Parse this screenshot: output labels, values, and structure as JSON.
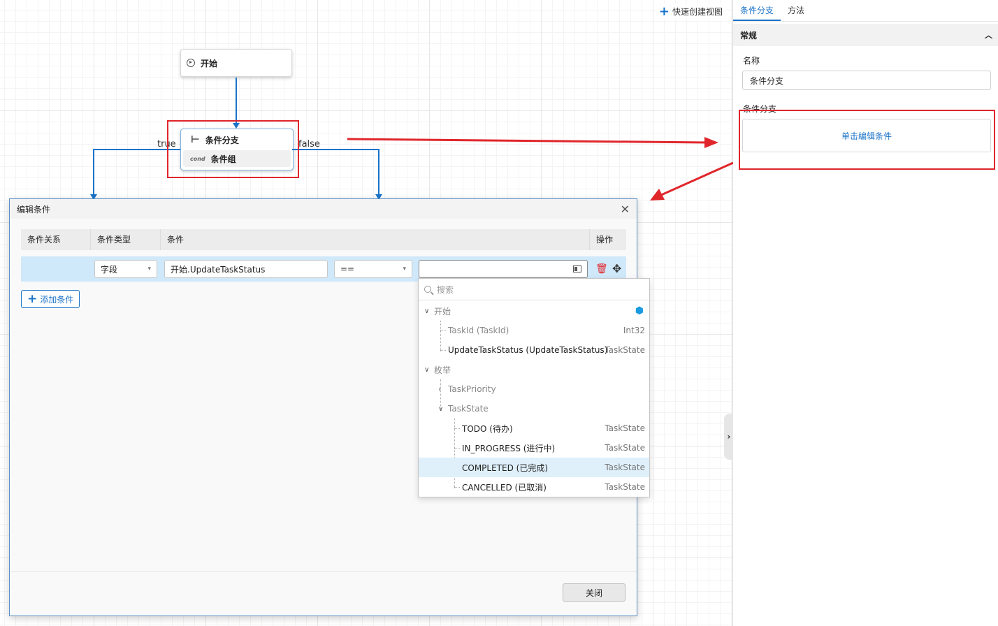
{
  "canvas": {
    "quick_create_label": "快速创建视图",
    "start_node_label": "开始",
    "branch_node_title": "条件分支",
    "branch_node_tag": "cond",
    "branch_node_group": "条件组",
    "edge_true": "true",
    "edge_false": "false"
  },
  "panel": {
    "tabs": [
      {
        "label": "条件分支",
        "active": true
      },
      {
        "label": "方法",
        "active": false
      }
    ],
    "section_title": "常规",
    "name_label": "名称",
    "name_value": "条件分支",
    "condition_label": "条件分支",
    "condition_link": "单击编辑条件"
  },
  "dialog": {
    "title": "编辑条件",
    "columns": [
      "条件关系",
      "条件类型",
      "条件",
      "操作"
    ],
    "row": {
      "relation": "",
      "type": "字段",
      "field": "开始.UpdateTaskStatus",
      "operator": "==",
      "value": ""
    },
    "add_label": "添加条件",
    "close_label": "关闭"
  },
  "dropdown": {
    "search_placeholder": "搜索",
    "items": [
      {
        "label": "开始",
        "type": ""
      },
      {
        "label": "TaskId (TaskId)",
        "type": "Int32"
      },
      {
        "label": "UpdateTaskStatus (UpdateTaskStatus)",
        "type": "TaskState"
      },
      {
        "label": "枚举",
        "type": ""
      },
      {
        "label": "TaskPriority",
        "type": ""
      },
      {
        "label": "TaskState",
        "type": ""
      },
      {
        "label": "TODO (待办)",
        "type": "TaskState"
      },
      {
        "label": "IN_PROGRESS (进行中)",
        "type": "TaskState"
      },
      {
        "label": "COMPLETED (已完成)",
        "type": "TaskState"
      },
      {
        "label": "CANCELLED (已取消)",
        "type": "TaskState"
      }
    ]
  },
  "colors": {
    "accent": "#1a73c9",
    "highlight_red": "#e0262b",
    "row_selected": "#cfe8fa"
  }
}
